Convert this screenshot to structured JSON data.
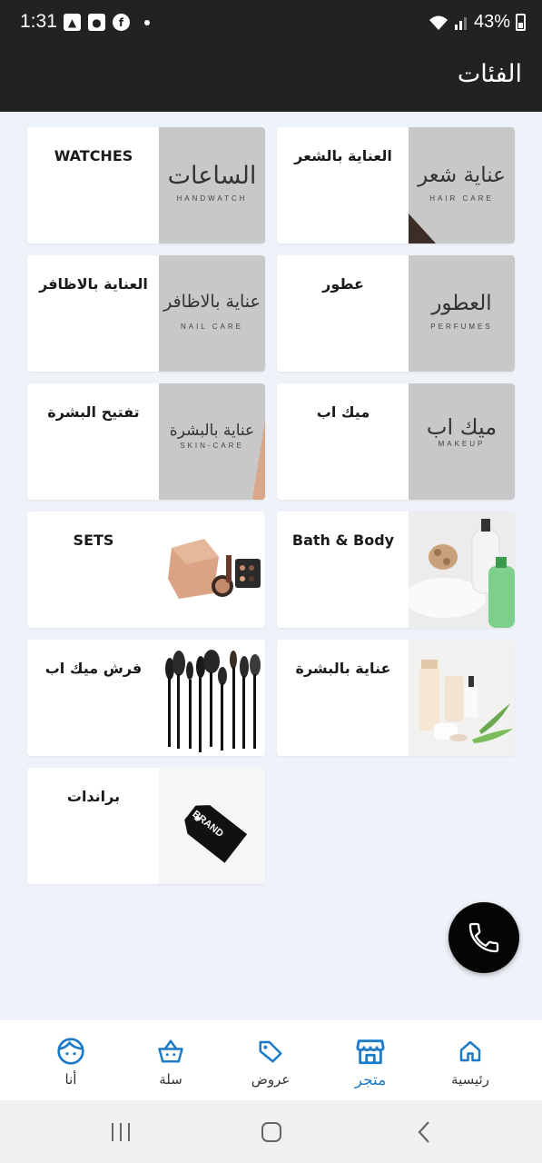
{
  "status_bar": {
    "time": "1:31",
    "battery": "43%"
  },
  "app_bar": {
    "title": "الفئات"
  },
  "categories": [
    {
      "label": "العناية بالشعر",
      "image_title": "عناية شعر",
      "image_subtitle": "HAIR CARE"
    },
    {
      "label": "WATCHES",
      "image_title": "الساعات",
      "image_subtitle": "HANDWATCH"
    },
    {
      "label": "عطور",
      "image_title": "العطور",
      "image_subtitle": "PERFUMES"
    },
    {
      "label": "العناية بالاظافر",
      "image_title": "عناية بالاظافر",
      "image_subtitle": "NAIL CARE"
    },
    {
      "label": "ميك اب",
      "image_title": "ميك اب",
      "image_subtitle": "MAKEUP"
    },
    {
      "label": "تفتيح البشرة",
      "image_title": "عناية بالبشرة",
      "image_subtitle": "SKIN-CARE"
    },
    {
      "label": "Bath & Body"
    },
    {
      "label": "SETS"
    },
    {
      "label": "عناية بالبشرة"
    },
    {
      "label": "فرش ميك اب"
    },
    {
      "label": "براندات",
      "image_title": "BRAND"
    }
  ],
  "bottom_nav": [
    {
      "label": "رئيسية",
      "icon": "home-icon"
    },
    {
      "label": "متجر",
      "icon": "store-icon",
      "active": true
    },
    {
      "label": "عروض",
      "icon": "tag-icon"
    },
    {
      "label": "سلة",
      "icon": "basket-icon"
    },
    {
      "label": "أنا",
      "icon": "face-icon"
    }
  ],
  "colors": {
    "header": "#222222",
    "accent": "#1c7ac8",
    "background": "#eef3f9"
  }
}
